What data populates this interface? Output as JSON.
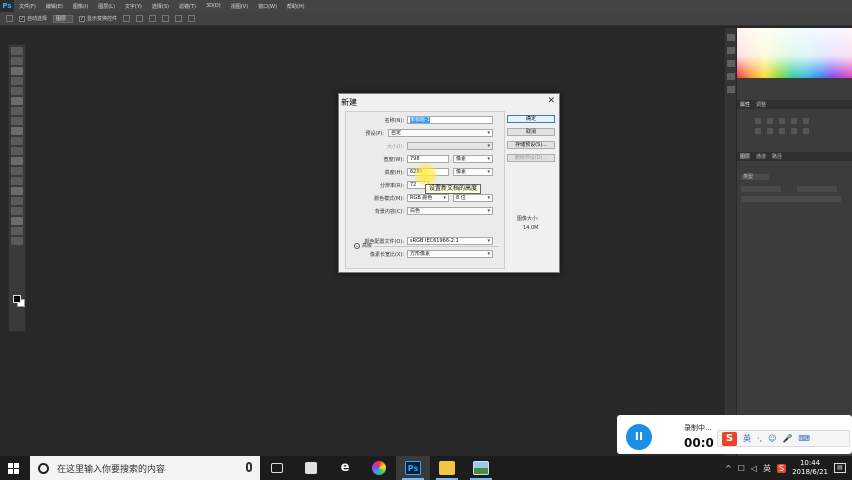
{
  "app": {
    "logo": "Ps",
    "menu": [
      "文件(F)",
      "编辑(E)",
      "图像(I)",
      "图层(L)",
      "文字(Y)",
      "选择(S)",
      "滤镜(T)",
      "3D(D)",
      "视图(V)",
      "窗口(W)",
      "帮助(H)"
    ]
  },
  "options": {
    "auto_select": "自动选择",
    "layer_select": "图层",
    "show_transform": "显示变换控件"
  },
  "panels": {
    "tabs_top": [
      "颜色",
      "色板"
    ],
    "tabs_mid": [
      "属性",
      "调整"
    ],
    "tabs_bottom": [
      "图层",
      "通道",
      "路径"
    ],
    "layer_kind": "类型"
  },
  "dialog": {
    "title": "新建",
    "fields": {
      "name_label": "名称(N):",
      "name_value": "未标题-1",
      "preset_label": "预设(P):",
      "preset_value": "自定",
      "size_label": "大小(I):",
      "width_label": "宽度(W):",
      "width_value": "798",
      "width_unit": "像素",
      "height_label": "高度(H):",
      "height_value": "6280",
      "height_unit": "像素",
      "resolution_label": "分辨率(R):",
      "resolution_value": "72",
      "color_mode_label": "颜色模式(M):",
      "color_mode_value": "RGB 颜色",
      "bit_depth": "8 位",
      "background_label": "背景内容(C):",
      "background_value": "白色",
      "advanced_label": "高级",
      "profile_label": "颜色配置文件(O):",
      "profile_value": "sRGB IEC61966-2.1",
      "aspect_label": "像素长宽比(X):",
      "aspect_value": "方形像素"
    },
    "buttons": {
      "ok": "确定",
      "cancel": "取消",
      "save_preset": "存储预设(S)...",
      "delete_preset": "删除预设(D)..."
    },
    "image_size_label": "图像大小:",
    "image_size_value": "14.0M",
    "tooltip": "设置新文档的高度"
  },
  "recorder": {
    "status": "录制中...",
    "timer": "00:0",
    "pause_glyph": "II"
  },
  "ime": {
    "logo": "S",
    "lang": "英",
    "items": [
      "·,",
      "☺",
      "🎤",
      "⌨"
    ]
  },
  "taskbar": {
    "search_placeholder": "在这里输入你要搜索的内容",
    "apps": [
      "task-view",
      "store",
      "edge",
      "color",
      "photoshop",
      "explorer",
      "photos"
    ],
    "ps_label": "Ps",
    "tray": {
      "chevron": "^",
      "ime_lang": "英",
      "time": "10:44",
      "date": "2018/6/21"
    }
  }
}
